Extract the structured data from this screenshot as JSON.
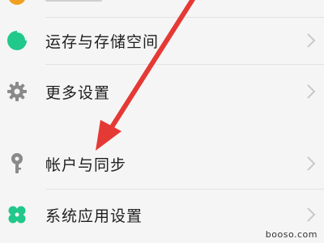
{
  "settings": {
    "items": [
      {
        "label": "运存与存储空间",
        "icon": "pie-chart-icon",
        "icon_color": "#20c88a"
      },
      {
        "label": "更多设置",
        "icon": "gear-icon",
        "icon_color": "#8a8a8a"
      },
      {
        "label": "帐户与同步",
        "icon": "key-icon",
        "icon_color": "#8a8a8a"
      },
      {
        "label": "系统应用设置",
        "icon": "clover-icon",
        "icon_color": "#20c88a"
      }
    ]
  },
  "annotation": {
    "arrow_color": "#e53935"
  },
  "watermark": {
    "text": "booso.com"
  }
}
